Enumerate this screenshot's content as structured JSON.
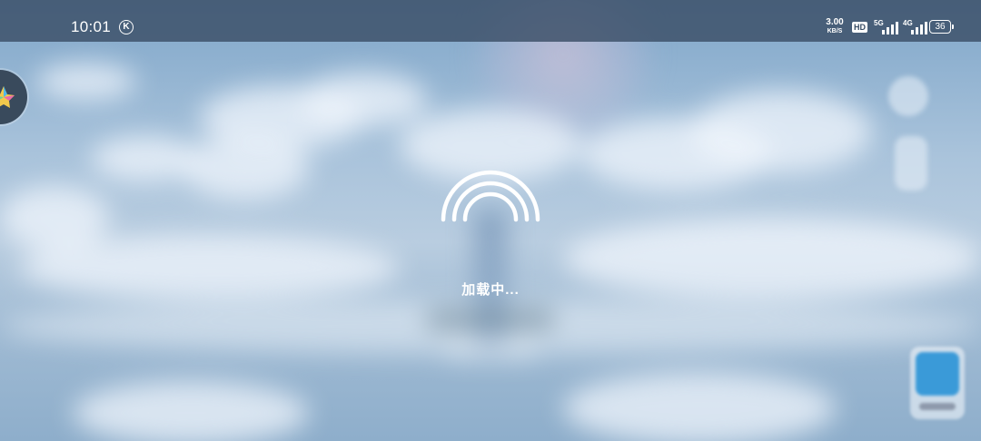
{
  "status_bar": {
    "time": "10:01",
    "k_badge": "K",
    "net_speed_value": "3.00",
    "net_speed_unit": "KB/S",
    "hd_label": "HD",
    "sim1_label": "5G",
    "sim2_label": "4G",
    "battery": "36"
  },
  "loading": {
    "text": "加载中..."
  },
  "colors": {
    "status_bar_bg": "#3a4e66",
    "loader": "#ffffff",
    "widget_accent": "#3a9ad8"
  },
  "icons": {
    "loader": "concentric-arcs-icon",
    "float_ball": "star-logo-icon",
    "signal": "signal-bars-icon",
    "battery": "battery-icon"
  }
}
